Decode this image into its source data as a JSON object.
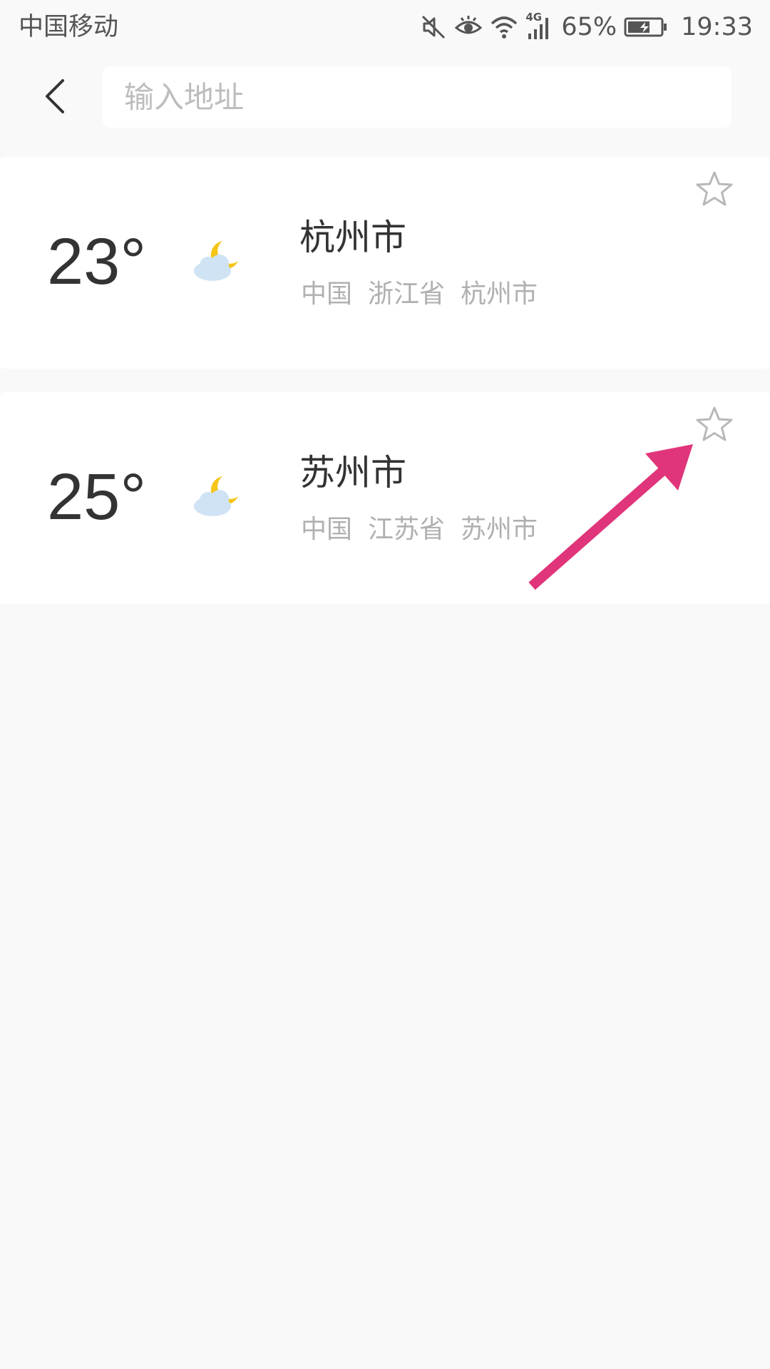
{
  "status_bar": {
    "carrier": "中国移动",
    "network": "4G",
    "battery": "65%",
    "time": "19:33",
    "icons": [
      "mute-icon",
      "eye-icon",
      "wifi-icon",
      "signal-icon",
      "battery-icon"
    ]
  },
  "header": {
    "back_icon": "chevron-left-icon",
    "search_placeholder": "输入地址",
    "search_value": ""
  },
  "cities": [
    {
      "temperature": "23°",
      "weather_icon": "cloud-moon-icon",
      "name": "杭州市",
      "region": [
        "中国",
        "浙江省",
        "杭州市"
      ],
      "favorite_icon": "star-outline-icon"
    },
    {
      "temperature": "25°",
      "weather_icon": "cloud-moon-icon",
      "name": "苏州市",
      "region": [
        "中国",
        "江苏省",
        "苏州市"
      ],
      "favorite_icon": "star-outline-icon"
    }
  ],
  "colors": {
    "background": "#f9f9f9",
    "card": "#ffffff",
    "primary_text": "#333333",
    "secondary_text": "#b0b0b0",
    "star_stroke": "#b8b8b8",
    "annotation_arrow": "#e0357a",
    "moon": "#f5c518",
    "cloud": "#cfe3f5"
  }
}
